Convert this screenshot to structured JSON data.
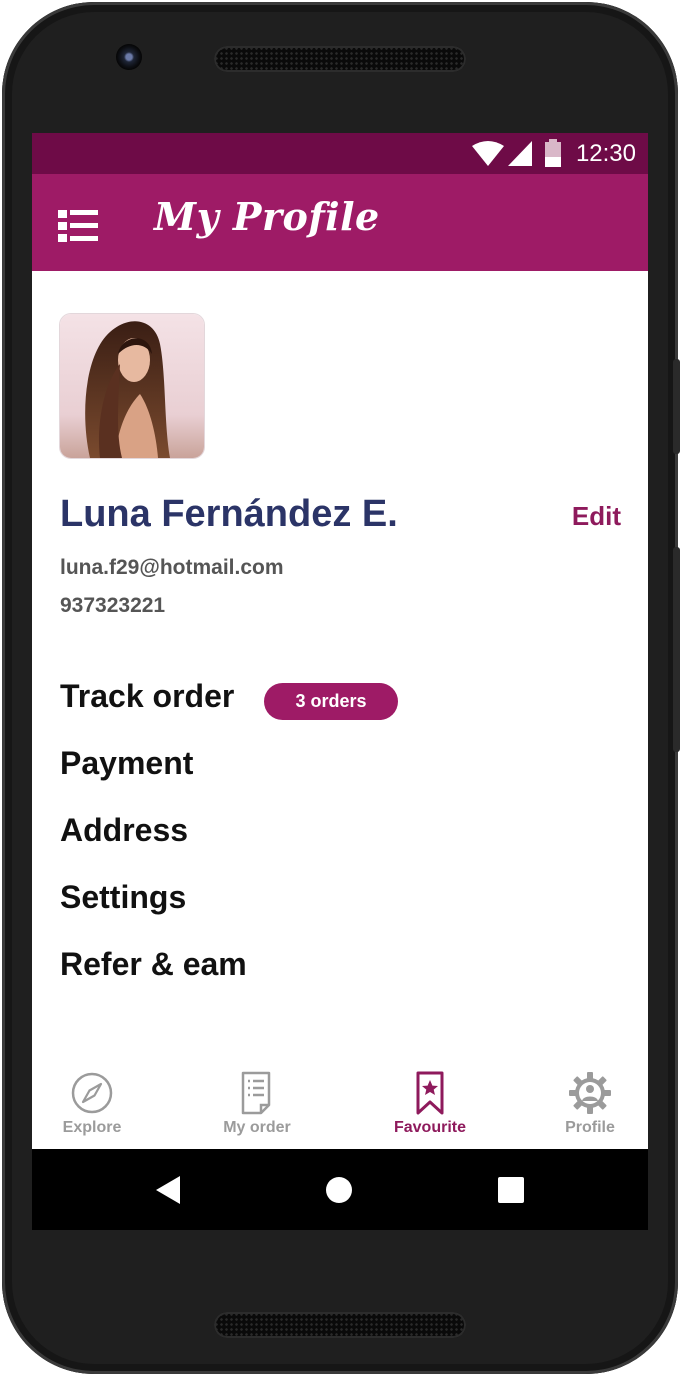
{
  "status_bar": {
    "time": "12:30"
  },
  "app_bar": {
    "title": "My Profile"
  },
  "profile": {
    "name": "Luna Fernández E.",
    "edit_label": "Edit",
    "email": "luna.f29@hotmail.com",
    "phone": "937323221"
  },
  "menu": {
    "items": [
      {
        "label": "Track order",
        "badge": "3 orders"
      },
      {
        "label": "Payment"
      },
      {
        "label": "Address"
      },
      {
        "label": "Settings"
      },
      {
        "label": "Refer & eam"
      }
    ]
  },
  "bottom_nav": {
    "items": [
      {
        "label": "Explore",
        "icon": "compass-icon"
      },
      {
        "label": "My order",
        "icon": "receipt-icon"
      },
      {
        "label": "Favourite",
        "icon": "bookmark-star-icon",
        "active": true
      },
      {
        "label": "Profile",
        "icon": "gear-user-icon"
      }
    ]
  },
  "colors": {
    "brand": "#9e1b66",
    "status_bar": "#6e0b47",
    "name_text": "#2b3467",
    "inactive_nav": "#9b9b9b"
  }
}
